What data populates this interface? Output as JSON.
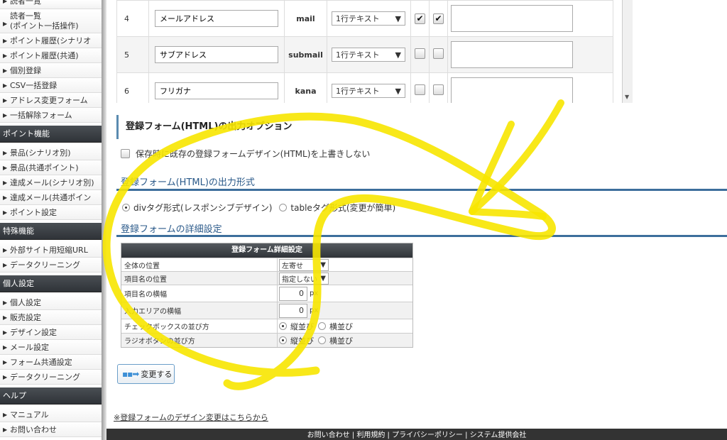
{
  "sidebar": {
    "groups": [
      {
        "items": [
          {
            "label": "読者一覧",
            "tall": false
          },
          {
            "label": "読者一覧\n(ポイント一括操作)",
            "tall": true
          },
          {
            "label": "ポイント履歴(シナリオ別)",
            "tall": false
          },
          {
            "label": "ポイント履歴(共通)",
            "tall": false
          },
          {
            "label": "個別登録",
            "tall": false
          },
          {
            "label": "CSV一括登録",
            "tall": false
          },
          {
            "label": "アドレス変更フォーム",
            "tall": false
          },
          {
            "label": "一括解除フォーム",
            "tall": false
          }
        ]
      },
      {
        "header": "ポイント機能",
        "items": [
          {
            "label": "景品(シナリオ別)"
          },
          {
            "label": "景品(共通ポイント)"
          },
          {
            "label": "達成メール(シナリオ別)"
          },
          {
            "label": "達成メール(共通ポイント)"
          },
          {
            "label": "ポイント設定"
          }
        ]
      },
      {
        "header": "特殊機能",
        "items": [
          {
            "label": "外部サイト用短縮URL"
          },
          {
            "label": "データクリーニング"
          }
        ]
      },
      {
        "header": "個人設定",
        "items": [
          {
            "label": "個人設定"
          },
          {
            "label": "販売設定"
          },
          {
            "label": "デザイン設定"
          },
          {
            "label": "メール設定"
          },
          {
            "label": "フォーム共通設定"
          },
          {
            "label": "データクリーニング"
          }
        ]
      },
      {
        "header": "ヘルプ",
        "items": [
          {
            "label": "マニュアル"
          },
          {
            "label": "お問い合わせ"
          }
        ]
      }
    ]
  },
  "fields": {
    "rows": [
      {
        "num": "4",
        "name": "メールアドレス",
        "key": "mail",
        "type": "1行テキスト",
        "check1": true,
        "check2": true
      },
      {
        "num": "5",
        "name": "サブアドレス",
        "key": "submail",
        "type": "1行テキスト",
        "check1": false,
        "check2": false
      },
      {
        "num": "6",
        "name": "フリガナ",
        "key": "kana",
        "type": "1行テキスト",
        "check1": false,
        "check2": false
      }
    ]
  },
  "options": {
    "title": "登録フォーム(HTML)の出力オプション",
    "overwrite_label": "保存時に既存の登録フォームデザイン(HTML)を上書きしない",
    "format_heading": "登録フォーム(HTML)の出力形式",
    "format_div": "divタグ形式(レスポンシブデザイン)",
    "format_table": "tableタグ形式(変更が簡単)",
    "detail_heading": "登録フォームの詳細設定"
  },
  "detail": {
    "header": "登録フォーム詳細設定",
    "rows": {
      "position_label": "全体の位置",
      "position_value": "左寄せ",
      "item_pos_label": "項目名の位置",
      "item_pos_value": "指定しない",
      "item_width_label": "項目名の横幅",
      "item_width_value": "0",
      "input_width_label": "入力エリアの横幅",
      "input_width_value": "0",
      "checkbox_label": "チェックボックスの並び方",
      "radio_label": "ラジオボタンの並び方",
      "unit": "px",
      "vertical": "縦並び",
      "horizontal": "横並び"
    }
  },
  "submit_label": "変更する",
  "design_link": "※登録フォームのデザイン変更はこちらから",
  "footer_text": "お問い合わせ | 利用規約 | プライバシーポリシー | システム提供会社"
}
